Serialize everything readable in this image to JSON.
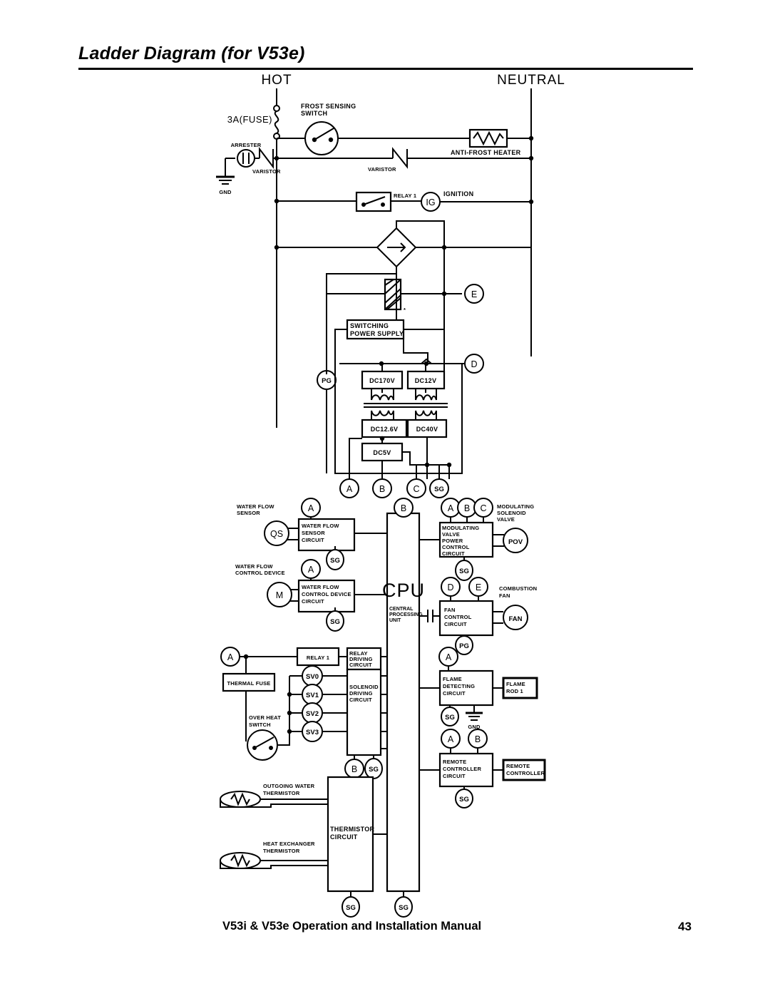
{
  "page": {
    "title": "Ladder Diagram (for V53e)",
    "footer_text": "V53i & V53e Operation and Installation Manual",
    "footer_page": "43"
  },
  "rails": {
    "hot": "HOT",
    "neutral": "NEUTRAL"
  },
  "mains_section": {
    "fuse": "3A(FUSE)",
    "arrester": "ARRESTER",
    "varistor_left": "VARISTOR",
    "varistor_mid": "VARISTOR",
    "gnd": "GND",
    "frost_sensing_switch": "FROST SENSING\nSWITCH",
    "frost_sensing_switch_l1": "FROST SENSING",
    "frost_sensing_switch_l2": "SWITCH",
    "anti_frost_heater": "ANTI-FROST HEATER",
    "relay_1": "RELAY 1",
    "ignition_node": "IG",
    "ignition_label": "IGNITION"
  },
  "power_supply": {
    "switching_power_supply_l1": "SWITCHING",
    "switching_power_supply_l2": "POWER SUPPLY",
    "node_pg": "PG",
    "node_e": "E",
    "node_d": "D",
    "rails": [
      {
        "label": "DC170V"
      },
      {
        "label": "DC12V"
      },
      {
        "label": "DC12.6V"
      },
      {
        "label": "DC40V"
      },
      {
        "label": "DC5V"
      }
    ],
    "output_nodes": [
      "A",
      "B",
      "C",
      "SG"
    ]
  },
  "cpu": {
    "label": "CPU",
    "sub_l1": "CENTRAL",
    "sub_l2": "PROCESSING",
    "sub_l3": "UNIT",
    "top_node": "B",
    "bottom_node": "SG"
  },
  "left_blocks": [
    {
      "name": "water-flow-sensor",
      "device_label_l1": "WATER FLOW",
      "device_label_l2": "SENSOR",
      "device_node": "QS",
      "circuit_l1": "WATER FLOW",
      "circuit_l2": "SENSOR",
      "circuit_l3": "CIRCUIT",
      "top_node": "A",
      "bottom_node": "SG"
    },
    {
      "name": "water-flow-control-device",
      "device_label_l1": "WATER FLOW",
      "device_label_l2": "CONTROL DEVICE",
      "device_node": "M",
      "circuit_l1": "WATER FLOW",
      "circuit_l2": "CONTROL DEVICE",
      "circuit_l3": "CIRCUIT",
      "top_node": "A",
      "bottom_node": "SG"
    }
  ],
  "relay_solenoid": {
    "source_node": "A",
    "thermal_fuse": "THERMAL FUSE",
    "over_heat_switch_l1": "OVER HEAT",
    "over_heat_switch_l2": "SWITCH",
    "relay_1": "RELAY 1",
    "relay_driving_l1": "RELAY",
    "relay_driving_l2": "DRIVING",
    "relay_driving_l3": "CIRCUIT",
    "solenoid_driving_l1": "SOLENOID",
    "solenoid_driving_l2": "DRIVING",
    "solenoid_driving_l3": "CIRCUIT",
    "solenoids": [
      "SV0",
      "SV1",
      "SV2",
      "SV3"
    ],
    "bottom_nodes": [
      "B",
      "SG"
    ]
  },
  "thermistor": {
    "outgoing_l1": "OUTGOING WATER",
    "outgoing_l2": "THERMISTOR",
    "heat_exchanger_l1": "HEAT EXCHANGER",
    "heat_exchanger_l2": "THERMISTOR",
    "circuit_l1": "THERMISTOR",
    "circuit_l2": "CIRCUIT",
    "top_nodes": [
      "B",
      "SG"
    ],
    "bottom_node": "SG"
  },
  "right_blocks": [
    {
      "name": "modulating-valve-power-control-circuit",
      "top_nodes": [
        "A",
        "B",
        "C"
      ],
      "circuit_l1": "MODULATING",
      "circuit_l2": "VALVE",
      "circuit_l3": "POWER",
      "circuit_l4": "CONTROL",
      "circuit_l5": "CIRCUIT",
      "device_label_l1": "MODULATING",
      "device_label_l2": "SOLENOID",
      "device_label_l3": "VALVE",
      "device_node": "POV",
      "bottom_node": "SG"
    },
    {
      "name": "fan-control-circuit",
      "top_nodes": [
        "D",
        "E"
      ],
      "circuit_l1": "FAN",
      "circuit_l2": "CONTROL",
      "circuit_l3": "CIRCUIT",
      "device_label_l1": "COMBUSTION",
      "device_label_l2": "FAN",
      "device_node": "FAN",
      "bottom_node": "PG"
    },
    {
      "name": "flame-detecting-circuit",
      "top_nodes": [
        "A"
      ],
      "circuit_l1": "FLAME",
      "circuit_l2": "DETECTING",
      "circuit_l3": "CIRCUIT",
      "device_label_l1": "FLAME",
      "device_label_l2": "ROD 1",
      "bottom_node": "SG",
      "gnd": "GND"
    },
    {
      "name": "remote-controller-circuit",
      "top_nodes": [
        "A",
        "B"
      ],
      "circuit_l1": "REMOTE",
      "circuit_l2": "CONTROLLER",
      "circuit_l3": "CIRCUIT",
      "device_label_l1": "REMOTE",
      "device_label_l2": "CONTROLLER",
      "bottom_node": "SG"
    }
  ],
  "colors": {
    "ink": "#000000",
    "paper": "#ffffff"
  }
}
